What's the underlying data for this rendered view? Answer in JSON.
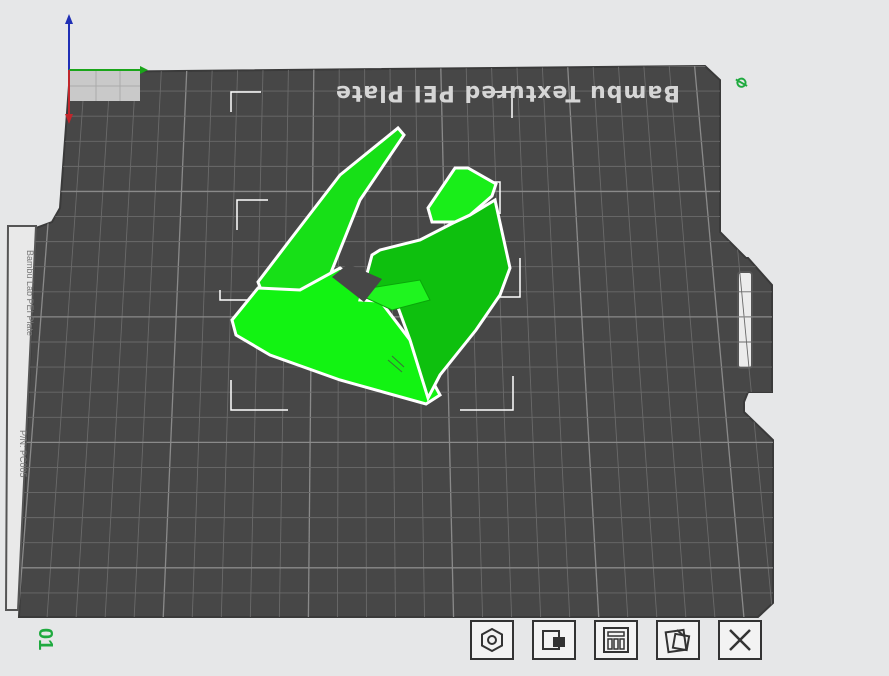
{
  "plate": {
    "name": "Bambu Textured PEI Plate",
    "number": "01",
    "label_glyph": "⌀",
    "strip_text_top": "Bambu Lab PEI Plate",
    "strip_text_bottom": "P/N: PC005"
  },
  "toolbar": {
    "items": [
      {
        "icon": "orient-icon",
        "name": "auto-orient-button"
      },
      {
        "icon": "lock-icon",
        "name": "lock-plate-button"
      },
      {
        "icon": "arrange-icon",
        "name": "arrange-button"
      },
      {
        "icon": "settings-icon",
        "name": "plate-settings-button"
      },
      {
        "icon": "close-icon",
        "name": "delete-plate-button"
      }
    ]
  },
  "colors": {
    "background": "#e6e7e8",
    "plate": "#474747",
    "grid": "#6f6f6f",
    "model": "#15e815",
    "model_dark": "#0ec00e",
    "accent_green": "#1faa3f",
    "axis_x": "#1aa51a",
    "axis_y": "#1f2fb5",
    "axis_z": "#c0262b"
  }
}
